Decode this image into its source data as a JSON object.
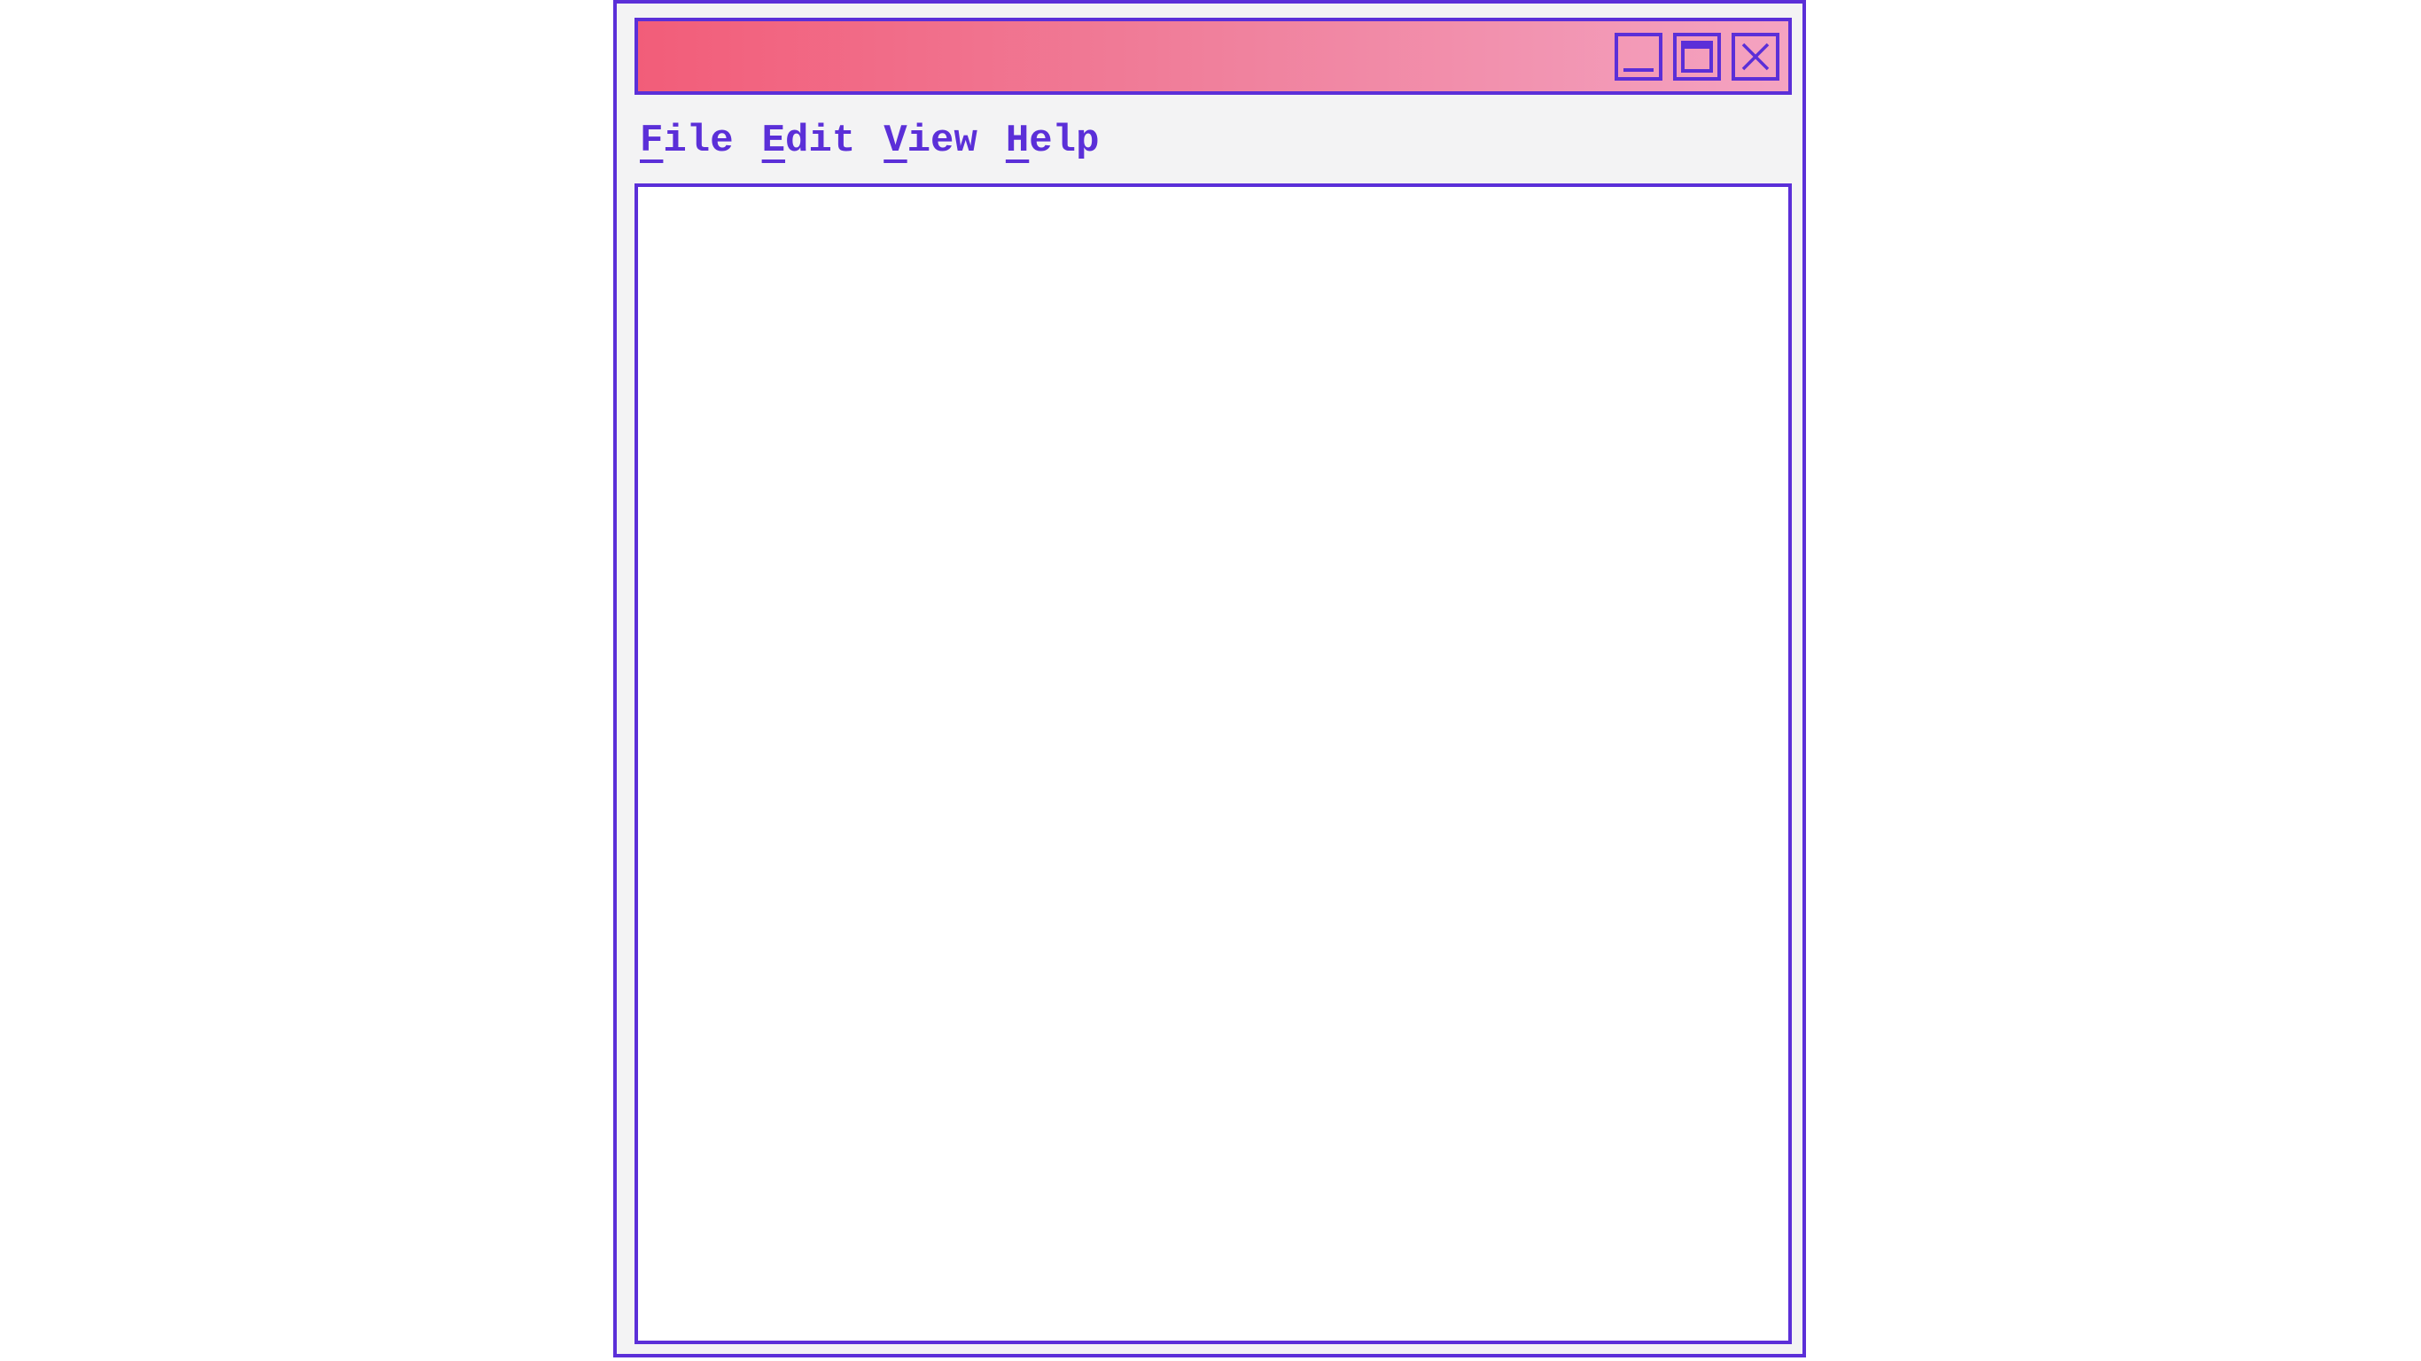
{
  "window": {
    "title": "",
    "colors": {
      "border": "#5b2fd8",
      "titlebar_gradient_start": "#f25d79",
      "titlebar_gradient_end": "#f4a3c1",
      "chrome_background": "#f3f3f4",
      "content_background": "#ffffff"
    },
    "controls": {
      "minimize_icon": "minimize-icon",
      "maximize_icon": "maximize-icon",
      "close_icon": "close-icon"
    }
  },
  "menubar": {
    "items": [
      {
        "mnemonic": "F",
        "rest": "ile"
      },
      {
        "mnemonic": "E",
        "rest": "dit"
      },
      {
        "mnemonic": "V",
        "rest": "iew"
      },
      {
        "mnemonic": "H",
        "rest": "elp"
      }
    ]
  }
}
